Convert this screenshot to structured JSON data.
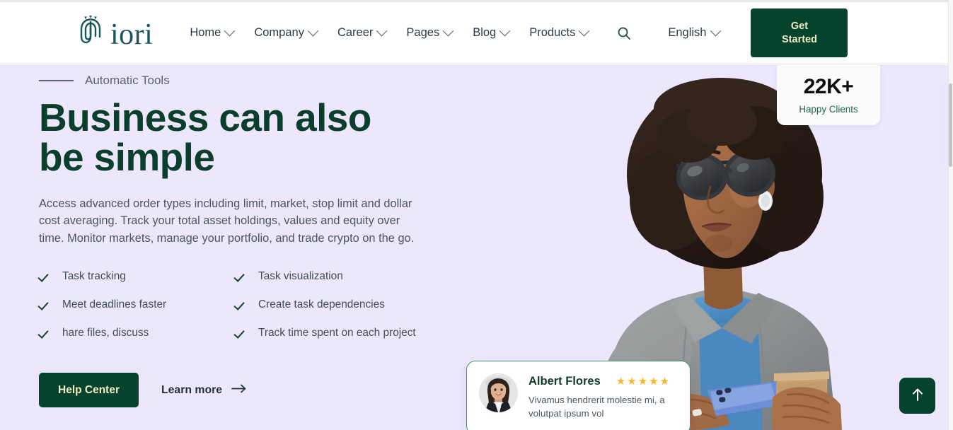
{
  "colors": {
    "brand_green": "#06432c",
    "heading_green": "#0b3f2b",
    "logo_teal": "#1a5560",
    "hero_bg": "#ece7fd",
    "cta_text": "#f2edc6",
    "star_gold": "#f5b729",
    "card_border_green": "#3d9e63"
  },
  "header": {
    "logo_text": "iori",
    "logo_icon": "fingerprint-icon",
    "nav": [
      {
        "label": "Home",
        "has_dropdown": true
      },
      {
        "label": "Company",
        "has_dropdown": true
      },
      {
        "label": "Career",
        "has_dropdown": true
      },
      {
        "label": "Pages",
        "has_dropdown": true
      },
      {
        "label": "Blog",
        "has_dropdown": true
      },
      {
        "label": "Products",
        "has_dropdown": true
      }
    ],
    "search_icon": "search-icon",
    "language": {
      "value": "English",
      "has_dropdown": true
    },
    "cta": {
      "line1": "Get",
      "line2": "Started"
    }
  },
  "hero": {
    "eyebrow": "Automatic Tools",
    "title": "Business can also be simple",
    "description": "Access advanced order types including limit, market, stop limit and dollar cost averaging. Track your total asset holdings, values and equity over time. Monitor markets, manage your portfolio, and trade crypto on the go.",
    "features": [
      "Task tracking",
      "Task visualization",
      "Meet deadlines faster",
      "Create task dependencies",
      "hare files, discuss",
      "Track time spent on each project"
    ],
    "primary_button": "Help Center",
    "secondary_link": "Learn more",
    "secondary_link_icon": "arrow-right-icon"
  },
  "stat_card": {
    "value": "22K+",
    "label": "Happy Clients"
  },
  "testimonial": {
    "avatar": "user-avatar",
    "name": "Albert Flores",
    "rating": 5,
    "star_glyph": "★",
    "text": "Vivamus hendrerit molestie mi, a volutpat ipsum vol"
  },
  "scroll_top": {
    "icon": "arrow-up-icon"
  }
}
